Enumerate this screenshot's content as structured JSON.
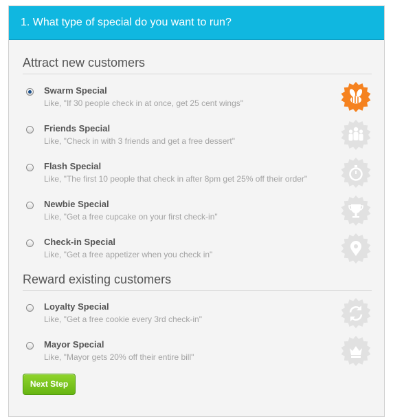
{
  "header": {
    "title": "1. What type of special do you want to run?"
  },
  "sections": [
    {
      "title": "Attract new customers",
      "options": [
        {
          "title": "Swarm Special",
          "desc": "Like, \"If 30 people check in at once, get 25 cent wings\"",
          "icon": "bee-icon",
          "selected": true
        },
        {
          "title": "Friends Special",
          "desc": "Like, \"Check in with 3 friends and get a free dessert\"",
          "icon": "people-icon",
          "selected": false
        },
        {
          "title": "Flash Special",
          "desc": "Like, \"The first 10 people that check in after 8pm get 25% off their order\"",
          "icon": "stopwatch-icon",
          "selected": false
        },
        {
          "title": "Newbie Special",
          "desc": "Like, \"Get a free cupcake on your first check-in\"",
          "icon": "trophy-icon",
          "selected": false
        },
        {
          "title": "Check-in Special",
          "desc": "Like, \"Get a free appetizer when you check in\"",
          "icon": "map-pin-icon",
          "selected": false
        }
      ]
    },
    {
      "title": "Reward existing customers",
      "options": [
        {
          "title": "Loyalty Special",
          "desc": "Like, \"Get a free cookie every 3rd check-in\"",
          "icon": "refresh-icon",
          "selected": false
        },
        {
          "title": "Mayor Special",
          "desc": "Like, \"Mayor gets 20% off their entire bill\"",
          "icon": "crown-icon",
          "selected": false
        }
      ]
    }
  ],
  "next_button": {
    "label": "Next Step"
  },
  "colors": {
    "header": "#10b7e0",
    "badge_active": "#f5821f",
    "badge_inactive": "#e1e1e1",
    "button": "#7cc61f"
  }
}
